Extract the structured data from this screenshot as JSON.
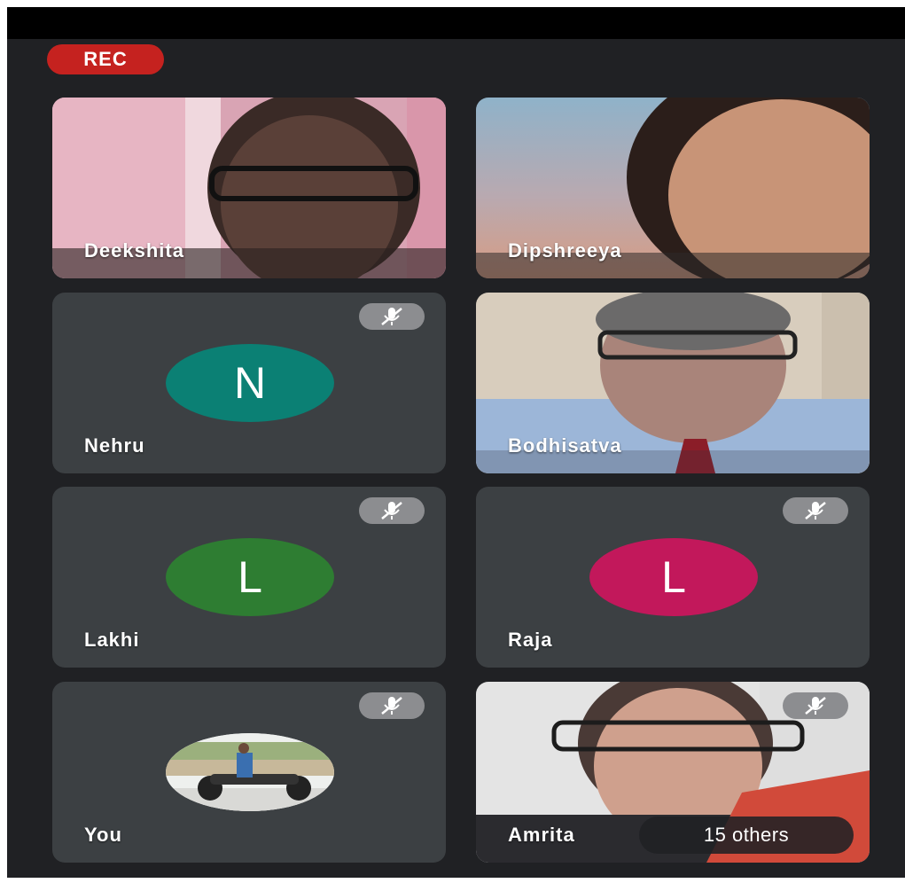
{
  "recording": {
    "label": "REC"
  },
  "participants": [
    {
      "name": "Deekshita"
    },
    {
      "name": "Dipshreeya"
    },
    {
      "name": "Nehru",
      "initial": "N",
      "color": "#0b8074"
    },
    {
      "name": "Bodhisatva"
    },
    {
      "name": "Lakhi",
      "initial": "L",
      "color": "#2e7d32"
    },
    {
      "name": "Raja",
      "initial": "L",
      "color": "#c2185b"
    },
    {
      "name": "You"
    },
    {
      "name": "Amrita"
    }
  ],
  "others_chip": {
    "label": "15 others"
  },
  "colors": {
    "background": "#202124",
    "tile": "#3c4043",
    "rec": "#c5221f"
  },
  "icons": {
    "mute": "mic-off-icon"
  }
}
